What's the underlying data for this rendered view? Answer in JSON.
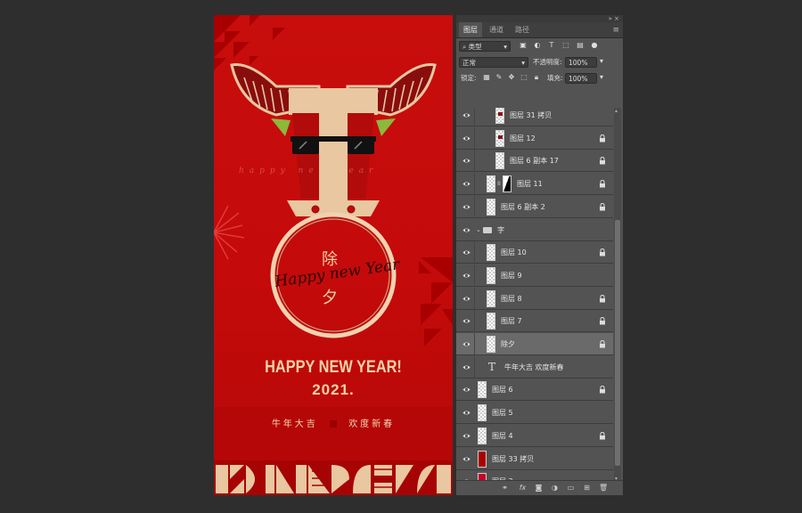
{
  "poster": {
    "title": "HAPPY NEW YEAR!",
    "year": "2021.",
    "chuxi_top": "除",
    "chuxi_bottom": "夕",
    "script_text": "Happy new Year",
    "faint_script": "happy new year",
    "slogan_left": "牛年大吉",
    "slogan_right": "欢度新春"
  },
  "panel": {
    "top_controls": "» ×",
    "tabs": [
      {
        "label": "图层",
        "active": true
      },
      {
        "label": "通道",
        "active": false
      },
      {
        "label": "路径",
        "active": false
      }
    ],
    "menu_icon": "≡",
    "filter": {
      "icon": "search-icon",
      "value": "类型"
    },
    "blend_mode": "正常",
    "opacity_label": "不透明度:",
    "opacity_value": "100%",
    "lock_label": "锁定:",
    "fill_label": "填充:",
    "fill_value": "100%"
  },
  "layers": [
    {
      "name": "图层 31 拷贝",
      "indent": 2,
      "locked": false,
      "thumb": "ox"
    },
    {
      "name": "图层 12",
      "indent": 2,
      "locked": true,
      "thumb": "ox"
    },
    {
      "name": "图层 6 副本 17",
      "indent": 2,
      "locked": true,
      "thumb": "checker"
    },
    {
      "name": "图层 11",
      "indent": 1,
      "locked": true,
      "thumb": "mask"
    },
    {
      "name": "图层 6 副本 2",
      "indent": 1,
      "locked": true,
      "thumb": "checker"
    },
    {
      "name": "字",
      "indent": 0,
      "locked": false,
      "thumb": "folder"
    },
    {
      "name": "图层 10",
      "indent": 1,
      "locked": true,
      "thumb": "checker"
    },
    {
      "name": "图层 9",
      "indent": 1,
      "locked": false,
      "thumb": "checker"
    },
    {
      "name": "图层 8",
      "indent": 1,
      "locked": true,
      "thumb": "checker"
    },
    {
      "name": "图层 7",
      "indent": 1,
      "locked": true,
      "thumb": "checker"
    },
    {
      "name": "除夕",
      "indent": 1,
      "locked": true,
      "thumb": "checker",
      "selected": true
    },
    {
      "name": "牛年大吉  欢度新春",
      "indent": 1,
      "locked": false,
      "thumb": "text"
    },
    {
      "name": "图层 6",
      "indent": 0,
      "locked": true,
      "thumb": "checker"
    },
    {
      "name": "图层 5",
      "indent": 0,
      "locked": false,
      "thumb": "checker"
    },
    {
      "name": "图层 4",
      "indent": 0,
      "locked": true,
      "thumb": "checker"
    },
    {
      "name": "图层 33 拷贝",
      "indent": 0,
      "locked": false,
      "thumb": "red"
    },
    {
      "name": "图层 3",
      "indent": 0,
      "locked": false,
      "thumb": "crimson"
    }
  ],
  "bottom_icons": [
    "link-icon",
    "fx-icon",
    "mask-icon",
    "adjustment-icon",
    "group-icon",
    "new-layer-icon",
    "trash-icon"
  ],
  "colors": {
    "poster_red": "#c40a0a",
    "gold": "#e9c7a0",
    "panel_bg": "#535353",
    "selected_row": "#6a6a6a"
  }
}
